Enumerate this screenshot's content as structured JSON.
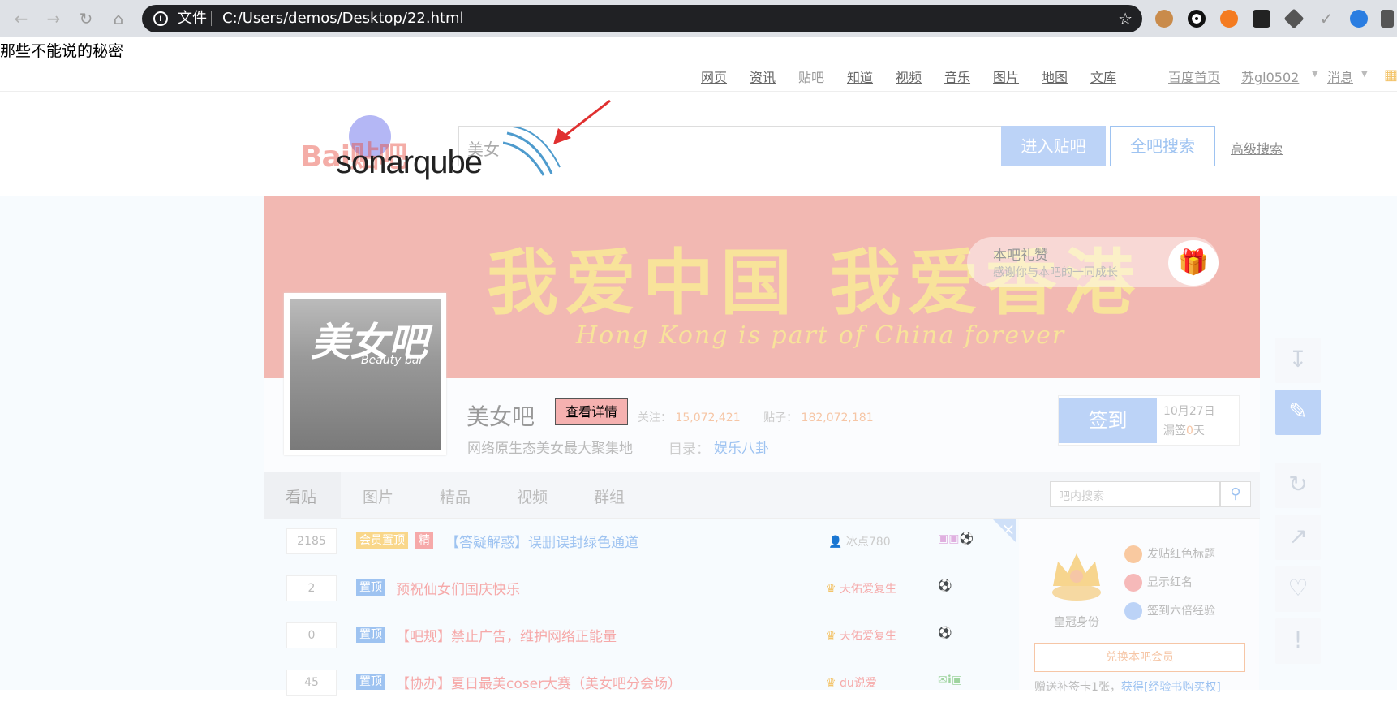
{
  "browser": {
    "scheme_label": "文件",
    "url": "C:/Users/demos/Desktop/22.html",
    "back_icon": "arrow-left-icon",
    "forward_icon": "arrow-right-icon",
    "reload_icon": "reload-icon",
    "home_icon": "home-icon",
    "bookmark_icon": "star-icon"
  },
  "page_title": "那些不能说的秘密",
  "top_nav": {
    "items": [
      "网页",
      "资讯",
      "贴吧",
      "知道",
      "视频",
      "音乐",
      "图片",
      "地图",
      "文库"
    ],
    "home": "百度首页",
    "user": "苏gl0502",
    "messages": "消息"
  },
  "search": {
    "value": "美女",
    "enter_button": "进入贴吧",
    "all_button": "全吧搜索",
    "advanced": "高级搜索"
  },
  "logo": {
    "baidu_text": "Bai贴吧",
    "overlay_text": "sonarqube"
  },
  "banner": {
    "headline": "我爱中国 我爱香港",
    "subline": "Hong Kong is part of China forever",
    "like_title": "本吧礼赞",
    "like_subtitle": "感谢你与本吧的一同成长"
  },
  "forum": {
    "avatar_title": "美女吧",
    "avatar_sub": "Beauty bar",
    "name": "美女吧",
    "detail_button": "查看详情",
    "follow_label": "关注：",
    "follow_count": "15,072,421",
    "posts_label": "贴子：",
    "posts_count": "182,072,181",
    "slogan": "网络原生态美女最大聚集地",
    "category_label": "目录：",
    "category": "娱乐八卦"
  },
  "sign": {
    "button": "签到",
    "date": "10月27日",
    "missed_prefix": "漏签",
    "missed_count": "0",
    "missed_suffix": "天"
  },
  "tabs": [
    "看贴",
    "图片",
    "精品",
    "视频",
    "群组"
  ],
  "inner_search_placeholder": "吧内搜索",
  "threads": [
    {
      "replies": "2185",
      "badges": [
        "会员置顶",
        "精"
      ],
      "title": "【答疑解惑】误删误封绿色通道",
      "author": "冰点780"
    },
    {
      "replies": "2",
      "badges": [
        "置顶"
      ],
      "title": "预祝仙女们国庆快乐",
      "author": "天佑爱复生"
    },
    {
      "replies": "0",
      "badges": [
        "置顶"
      ],
      "title": "【吧规】禁止广告，维护网络正能量",
      "author": "天佑爱复生"
    },
    {
      "replies": "45",
      "badges": [
        "置顶"
      ],
      "title": "【协办】夏日最美coser大赛（美女吧分会场）",
      "author": "du说爱"
    }
  ],
  "member": {
    "crown_label": "皇冠身份",
    "perks": [
      "发贴红色标题",
      "显示红名",
      "签到六倍经验"
    ],
    "exchange_button": "兑换本吧会员",
    "card_text_prefix": "赠送补签卡1张，",
    "card_text_link": "获得[经验书购买权]"
  },
  "colors": {
    "brand_blue": "#bcd3f7",
    "accent_red": "#f56c6c",
    "banner_bg": "#f2b8b2"
  }
}
